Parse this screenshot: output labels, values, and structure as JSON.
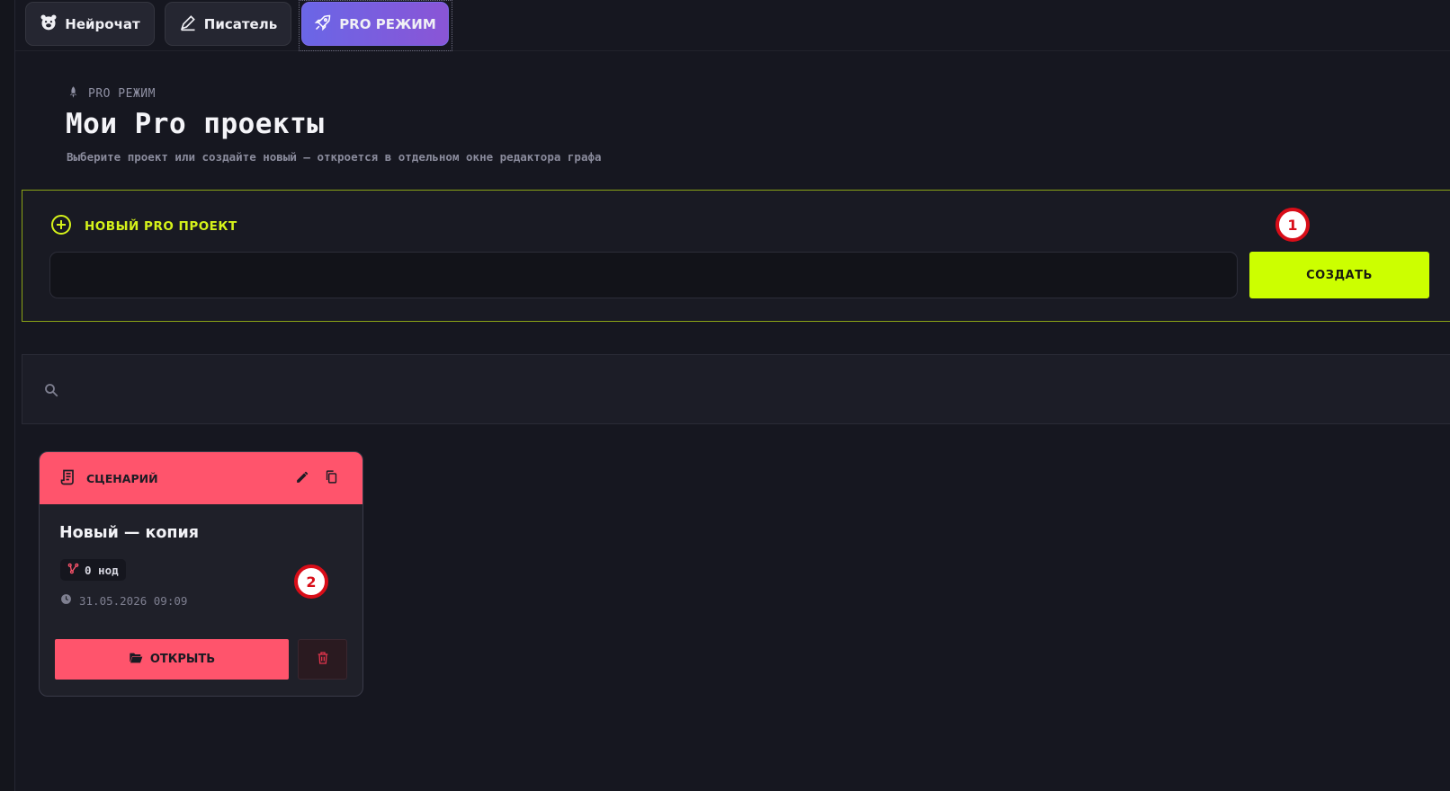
{
  "tabs": [
    {
      "label": "Нейрочат",
      "icon": "bear-face-icon"
    },
    {
      "label": "Писатель",
      "icon": "pen-writing-icon"
    },
    {
      "label": "PRO РЕЖИМ",
      "icon": "rocket-icon",
      "active": true
    }
  ],
  "header": {
    "eyebrow": "PRO РЕЖИМ",
    "eyebrow_icon": "rocket-icon",
    "title": "Мои Pro проекты",
    "subtitle": "Выберите проект или создайте новый — откроется в отдельном окне редактора графа"
  },
  "new_project": {
    "heading": "НОВЫЙ PRO ПРОЕКТ",
    "heading_icon": "plus-circle-icon",
    "input_value": "",
    "input_placeholder": "",
    "create_label": "СОЗДАТЬ"
  },
  "search": {
    "icon": "search-icon",
    "value": "",
    "placeholder": ""
  },
  "projects": [
    {
      "type_label": "СЦЕНАРИЙ",
      "type_icon": "script-scroll-icon",
      "title": "Новый — копия",
      "nodes_label": "0 нод",
      "date": "31.05.2026 09:09",
      "open_label": "ОТКРЫТЬ"
    }
  ],
  "markers": [
    "1",
    "2"
  ],
  "colors": {
    "background": "#161720",
    "accent_lime": "#ccff00",
    "accent_red": "#ff546c",
    "tab_active_from": "#6a66e6",
    "tab_active_to": "#8a55d6",
    "marker_red": "#d80d18"
  }
}
